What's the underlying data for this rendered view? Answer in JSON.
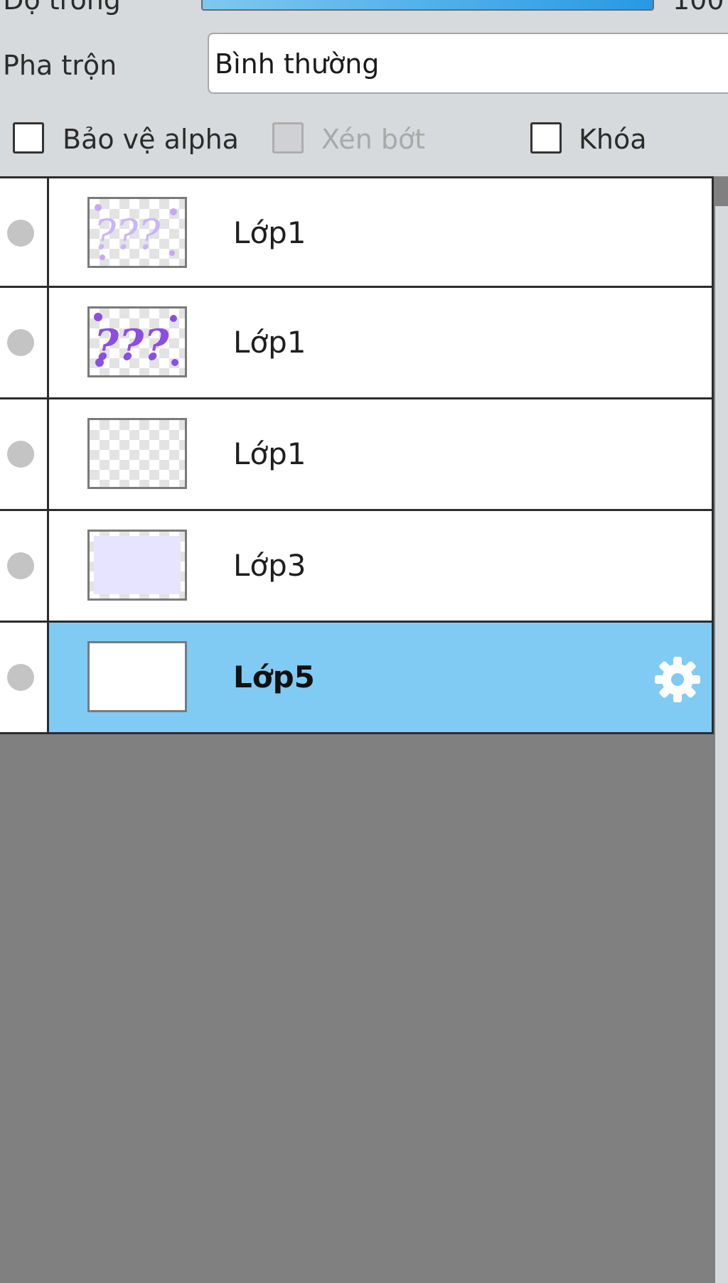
{
  "opacity": {
    "label": "Độ trong",
    "value": "100",
    "level_percent": 100
  },
  "blend": {
    "label": "Pha trộn",
    "value": "Bình thường"
  },
  "options": {
    "protect_alpha": "Bảo vệ alpha",
    "clipping": "Xén bớt",
    "lock": "Khóa"
  },
  "layers": [
    {
      "name": "Lớp1",
      "thumbnail": "light-purple-question-marks"
    },
    {
      "name": "Lớp1",
      "thumbnail": "purple-question-marks"
    },
    {
      "name": "Lớp1",
      "thumbnail": "transparent"
    },
    {
      "name": "Lớp3",
      "thumbnail": "lavender-fill"
    },
    {
      "name": "Lớp5",
      "thumbnail": "white",
      "selected": true,
      "icon": "gear-icon"
    }
  ],
  "colors": {
    "selected_row": "#7fcbf4",
    "panel_background": "#d6dadd",
    "empty_area": "#808080"
  }
}
